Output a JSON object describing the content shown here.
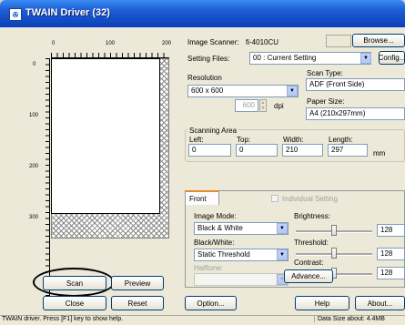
{
  "window": {
    "title": "TWAIN Driver (32)"
  },
  "ruler": {
    "top_labels": [
      "0",
      "100",
      "200"
    ],
    "left_labels": [
      "0",
      "100",
      "200",
      "300"
    ]
  },
  "scanner": {
    "label": "Image Scanner:",
    "value": "fi-4010CU",
    "browse": "Browse..."
  },
  "setting_files": {
    "label": "Setting Files:",
    "value": "00 : Current Setting",
    "config": "Config..."
  },
  "resolution": {
    "label": "Resolution",
    "value": "600 x 600",
    "custom": "600",
    "unit": "dpi"
  },
  "scan_type": {
    "label": "Scan Type:",
    "value": "ADF (Front Side)"
  },
  "paper_size": {
    "label": "Paper Size:",
    "value": "A4 (210x297mm)"
  },
  "scanning_area": {
    "label": "Scanning Area",
    "left_label": "Left:",
    "left": "0",
    "top_label": "Top:",
    "top": "0",
    "width_label": "Width:",
    "width": "210",
    "length_label": "Length:",
    "length": "297",
    "unit": "mm"
  },
  "tabs": {
    "front": "Front",
    "individual": "Individual Setting"
  },
  "image_mode": {
    "label": "Image Mode:",
    "value": "Black & White"
  },
  "bw": {
    "label": "Black/White:",
    "value": "Static Threshold"
  },
  "halftone": {
    "label": "Halftone:",
    "value": ""
  },
  "brightness": {
    "label": "Brightness:",
    "value": "128",
    "level": 0.5
  },
  "threshold": {
    "label": "Threshold:",
    "value": "128",
    "level": 0.5
  },
  "contrast": {
    "label": "Contrast:",
    "value": "128",
    "level": 0.5
  },
  "buttons": {
    "advance": "Advance...",
    "scan": "Scan",
    "preview": "Preview",
    "close": "Close",
    "reset": "Reset",
    "option": "Option...",
    "help": "Help",
    "about": "About..."
  },
  "status": {
    "left": "TWAIN driver. Press [F1] key to show help.",
    "right": "Data Size about:   4.4MB"
  },
  "colors": {
    "titlebar": "#0a3fb8",
    "face": "#ece9d8",
    "highlight_circle": "#000000"
  }
}
